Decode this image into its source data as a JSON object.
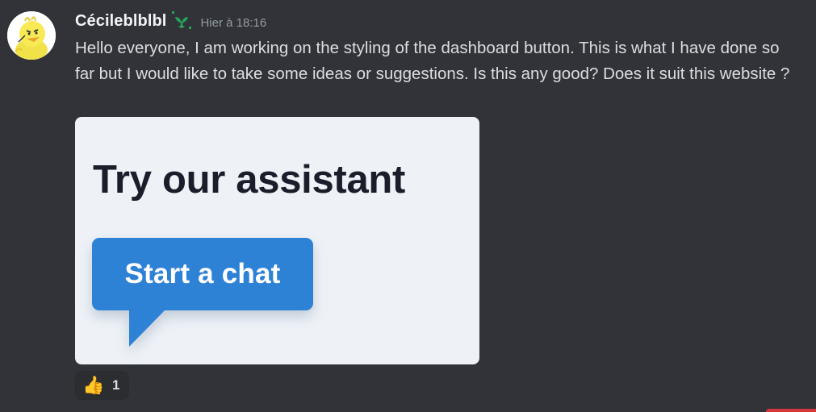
{
  "message": {
    "username": "Cécileblblbl",
    "timestamp": "Hier à 18:16",
    "badge_icon": "sprout-icon",
    "content": "Hello everyone, I am working on the styling of the dashboard button. This is what I have done so far but I would like to take some ideas or suggestions. Is this any good? Does it suit this website ?"
  },
  "attachment": {
    "title": "Try our assistant",
    "button_label": "Start a chat",
    "button_color": "#2f82d6",
    "background_color": "#eef2f7"
  },
  "reaction": {
    "emoji": "👍",
    "count": "1"
  },
  "colors": {
    "background": "#313338",
    "username": "#f2f3f5",
    "text": "#dbdee1",
    "timestamp": "#949ba4",
    "badge": "#23a55a"
  }
}
